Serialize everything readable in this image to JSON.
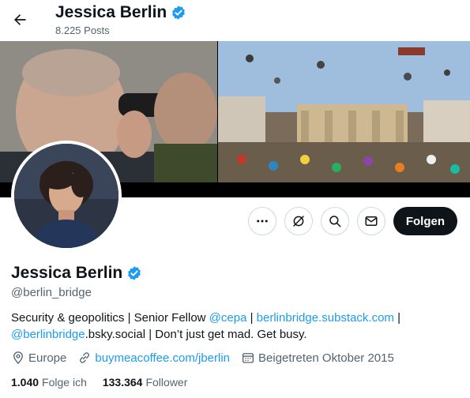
{
  "header": {
    "name": "Jessica Berlin",
    "posts": "8.225 Posts"
  },
  "actions": {
    "follow_label": "Folgen"
  },
  "profile": {
    "name": "Jessica Berlin",
    "handle": "@berlin_bridge",
    "bio": {
      "text1": "Security & geopolitics | Senior Fellow ",
      "mention_cepa": "@cepa",
      "sep1": " | ",
      "substack_link": "berlinbridge.substack.com",
      "sep2": " | ",
      "bsky_link": "@berlinbridge",
      "bsky_suffix": ".bsky.social | Don’t just get mad. Get busy."
    },
    "location": "Europe",
    "website": "buymeacoffee.com/jberlin",
    "joined": "Beigetreten Oktober 2015",
    "following_count": "1.040",
    "following_label": "Folge ich",
    "followers_count": "133.364",
    "followers_label": "Follower"
  },
  "colors": {
    "accent": "#1d9bf0",
    "text": "#0f1419",
    "muted": "#536471",
    "verified": "#1d9bf0"
  },
  "icons": [
    "back-arrow-icon",
    "verified-badge-icon",
    "more-icon",
    "grok-icon",
    "search-icon",
    "message-icon",
    "location-icon",
    "link-icon",
    "calendar-icon"
  ]
}
